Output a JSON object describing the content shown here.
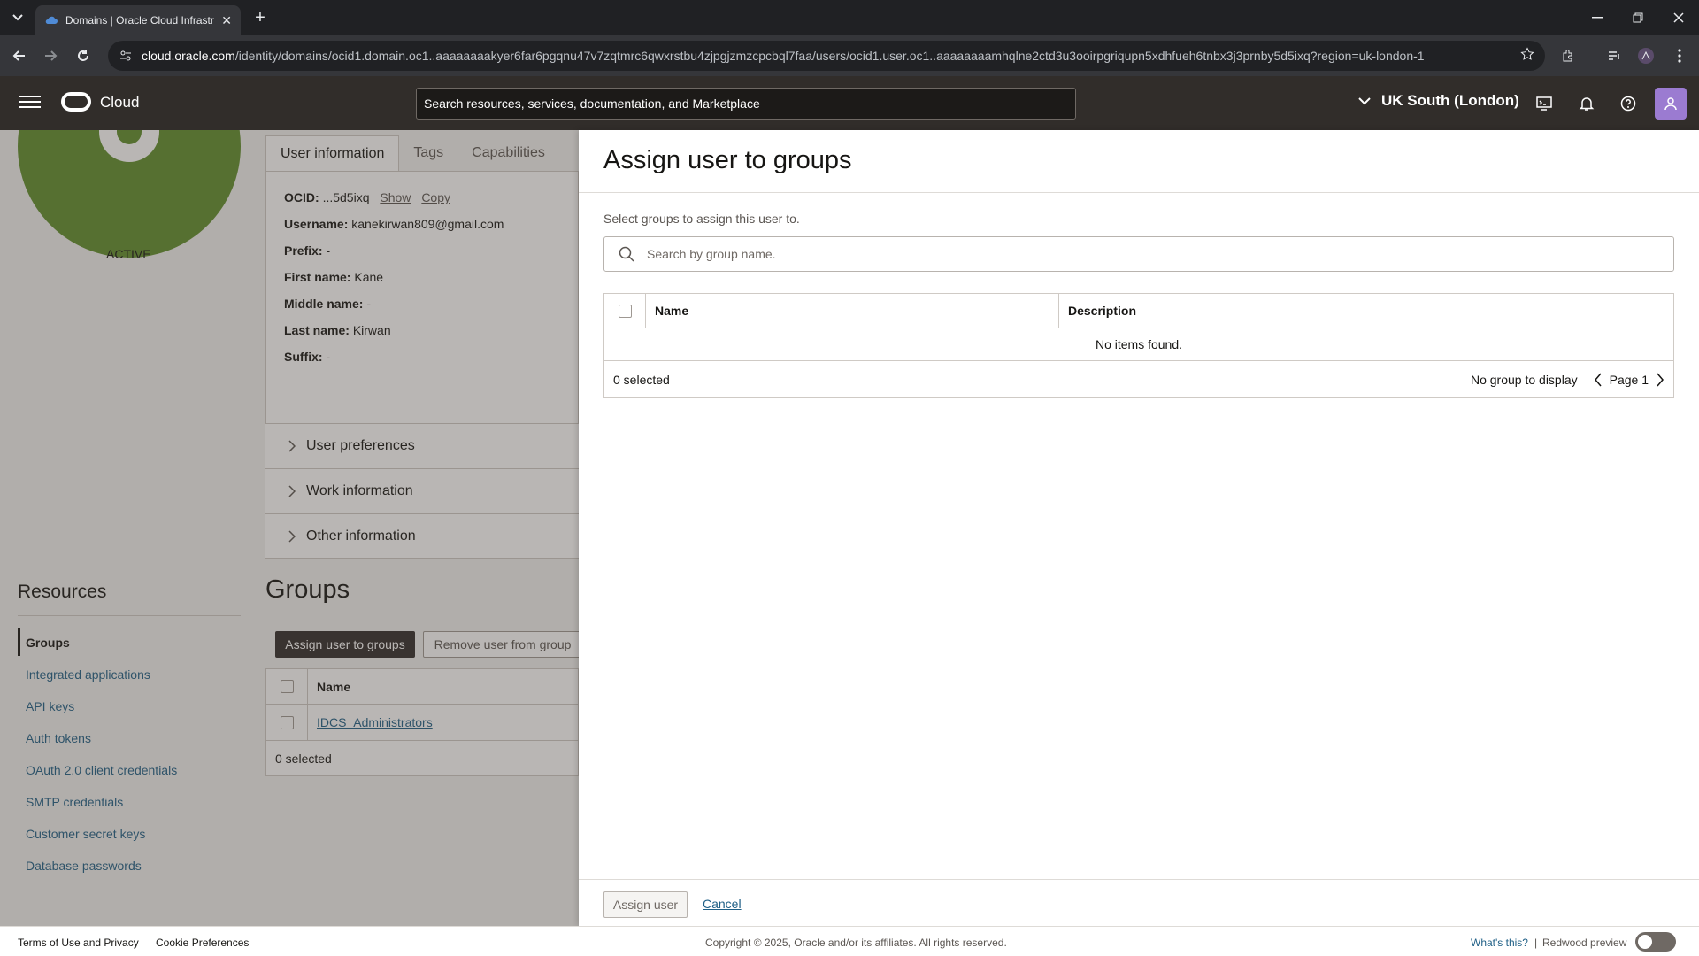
{
  "browser": {
    "tab_title": "Domains | Oracle Cloud Infrastr",
    "url_host": "cloud.oracle.com",
    "url_path": "/identity/domains/ocid1.domain.oc1..aaaaaaaakyer6far6pgqnu47v7zqtmrc6qwxrstbu4zjpgjzmzcpcbql7faa/users/ocid1.user.oc1..aaaaaaaamhqlne2ctd3u3ooirpgriqupn5xdhfueh6tnbx3j3prnby5d5ixq?region=uk-london-1"
  },
  "header": {
    "brand": "Cloud",
    "search_placeholder": "Search resources, services, documentation, and Marketplace",
    "region": "UK South (London)"
  },
  "user": {
    "status": "ACTIVE",
    "tabs": [
      "User information",
      "Tags",
      "Capabilities"
    ],
    "ocid_label": "OCID:",
    "ocid_value": "...5d5ixq",
    "show": "Show",
    "copy": "Copy",
    "fields": [
      {
        "label": "Username:",
        "value": "kanekirwan809@gmail.com"
      },
      {
        "label": "Prefix:",
        "value": "-"
      },
      {
        "label": "First name:",
        "value": "Kane"
      },
      {
        "label": "Middle name:",
        "value": "-"
      },
      {
        "label": "Last name:",
        "value": "Kirwan"
      },
      {
        "label": "Suffix:",
        "value": "-"
      }
    ],
    "sections": [
      "User preferences",
      "Work information",
      "Other information"
    ]
  },
  "resources": {
    "title": "Resources",
    "items": [
      "Groups",
      "Integrated applications",
      "API keys",
      "Auth tokens",
      "OAuth 2.0 client credentials",
      "SMTP credentials",
      "Customer secret keys",
      "Database passwords"
    ]
  },
  "groups": {
    "title": "Groups",
    "assign_btn": "Assign user to groups",
    "remove_btn": "Remove user from group",
    "col_name": "Name",
    "rows": [
      "IDCS_Administrators"
    ],
    "selected": "0 selected"
  },
  "panel": {
    "title": "Assign user to groups",
    "description": "Select groups to assign this user to.",
    "search_placeholder": "Search by group name.",
    "col_name": "Name",
    "col_description": "Description",
    "empty": "No items found.",
    "selected": "0 selected",
    "no_group": "No group to display",
    "page": "Page 1",
    "assign_btn": "Assign user",
    "cancel": "Cancel"
  },
  "footer": {
    "terms": "Terms of Use and Privacy",
    "cookies": "Cookie Preferences",
    "copyright": "Copyright © 2025, Oracle and/or its affiliates. All rights reserved.",
    "whats_this": "What's this?",
    "separator": "|",
    "redwood": "Redwood preview"
  }
}
